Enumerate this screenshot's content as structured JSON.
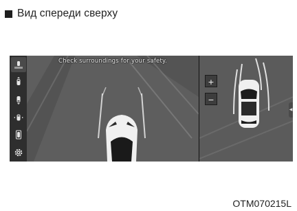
{
  "heading": {
    "text": "Вид спереди сверху"
  },
  "screen": {
    "caption": "Check surroundings for your safety.",
    "zoom_in_label": "+",
    "zoom_out_label": "−",
    "sidebar_icons": [
      "top-front-view-icon",
      "front-view-icon",
      "rear-view-icon",
      "side-view-icon",
      "rear-side-view-icon",
      "settings-gear-icon"
    ],
    "active_view": "top-front-view"
  },
  "figure_code": "OTM070215L"
}
